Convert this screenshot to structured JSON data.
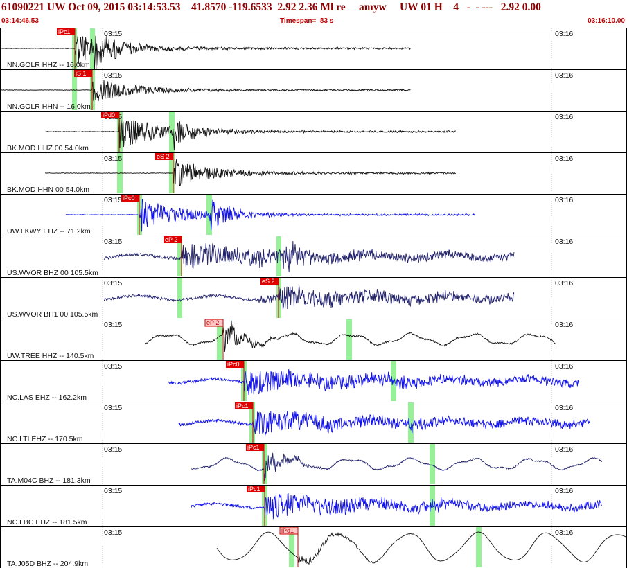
{
  "header": {
    "title": "61090221 UW Oct 09, 2015 03:14:53.53    41.8570 -119.6533  2.92 2.36 Ml re     amyw     UW 01 H    4   -  - ---   2.92 0.00",
    "time_start": "03:14:46.53",
    "timespan": "Timespan=  83 s",
    "time_end": "03:16:10.00"
  },
  "colors": {
    "black_trace": "#111111",
    "blue_trace": "#1010ee",
    "navy_trace": "#22226e",
    "pick_fill": "#e00000",
    "pick_alt_fill": "#ffc8c8",
    "pick_text": "#ffffff",
    "pick_alt_text": "#bb0000",
    "window_band": "#98f098",
    "frame": "#000000",
    "marker_text": "#111111"
  },
  "channels": [
    {
      "label": "NN.GOLR HHZ -- 16.0km",
      "left_time": "03:15",
      "right_time": "03:16",
      "pick": "iPc1",
      "pick_style": "solid",
      "trace_color": "black",
      "character": "impulsive"
    },
    {
      "label": "NN.GOLR HHN -- 16.0km",
      "left_time": "03:15",
      "right_time": "03:16",
      "pick": "iS 1",
      "pick_style": "solid",
      "trace_color": "black",
      "character": "impulsive"
    },
    {
      "label": "BK.MOD HHZ 00 54.0km",
      "left_time": "03:15",
      "right_time": "03:16",
      "pick": "iPd0",
      "pick_style": "solid",
      "trace_color": "black",
      "character": "impulsive"
    },
    {
      "label": "BK.MOD HHN 00 54.0km",
      "left_time": "03:15",
      "right_time": "03:16",
      "pick": "eS 2",
      "pick_style": "solid",
      "trace_color": "black",
      "character": "impulsive"
    },
    {
      "label": "UW.LKWY EHZ -- 71.2km",
      "left_time": "03:15",
      "right_time": "03:16",
      "pick": "iPc0",
      "pick_style": "solid",
      "trace_color": "blue",
      "character": "impulsive"
    },
    {
      "label": "US.WVOR BHZ 00 105.5km",
      "left_time": "03:15",
      "right_time": "03:16",
      "pick": "eP 2",
      "pick_style": "solid",
      "trace_color": "navy",
      "character": "noisy"
    },
    {
      "label": "US.WVOR BH1 00 105.5km",
      "left_time": "03:15",
      "right_time": "03:16",
      "pick": "eS 2",
      "pick_style": "solid",
      "trace_color": "navy",
      "character": "noisy"
    },
    {
      "label": "UW.TREE HHZ -- 140.5km",
      "left_time": "03:15",
      "right_time": "03:16",
      "pick": "eP 2",
      "pick_style": "outline",
      "trace_color": "black",
      "character": "wavy"
    },
    {
      "label": "NC.LAS EHZ -- 162.2km",
      "left_time": "03:15",
      "right_time": "03:16",
      "pick": "iPc0",
      "pick_style": "solid",
      "trace_color": "blue",
      "character": "noisy"
    },
    {
      "label": "NC.LTI EHZ -- 170.5km",
      "left_time": "03:15",
      "right_time": "03:16",
      "pick": "iPc1",
      "pick_style": "solid",
      "trace_color": "blue",
      "character": "noisy"
    },
    {
      "label": "TA.M04C BHZ -- 181.3km",
      "left_time": "03:15",
      "right_time": "03:16",
      "pick": "iPc1",
      "pick_style": "solid",
      "trace_color": "navy",
      "character": "wavy"
    },
    {
      "label": "NC.LBC EHZ -- 181.5km",
      "left_time": "03:15",
      "right_time": "03:16",
      "pick": "iPc1",
      "pick_style": "solid",
      "trace_color": "blue",
      "character": "noisy"
    },
    {
      "label": "TA.J05D BHZ -- 204.9km",
      "left_time": "03:15",
      "right_time": "03:16",
      "pick": "iPd1",
      "pick_style": "outline",
      "trace_color": "black",
      "character": "long-period"
    }
  ]
}
